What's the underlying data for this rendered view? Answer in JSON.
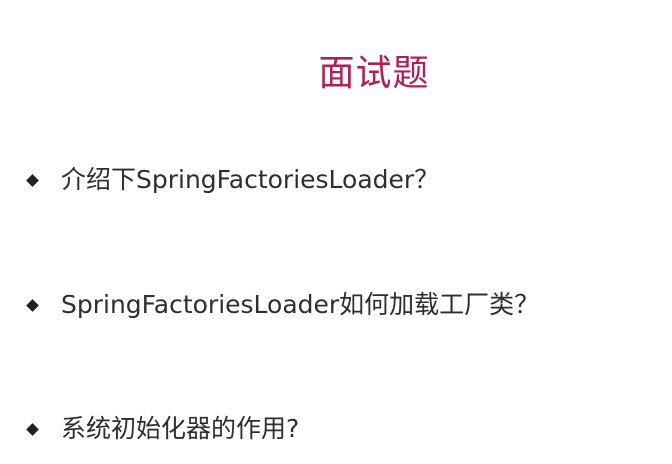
{
  "slide": {
    "title": "面试题",
    "questions": [
      {
        "text": "介绍下SpringFactoriesLoader？"
      },
      {
        "text": "SpringFactoriesLoader如何加载工厂类？"
      },
      {
        "text": "系统初始化器的作用?"
      }
    ]
  },
  "colors": {
    "title": "#b01f5a",
    "text": "#2e2e2e",
    "bullet": "#222222",
    "background": "#ffffff"
  }
}
